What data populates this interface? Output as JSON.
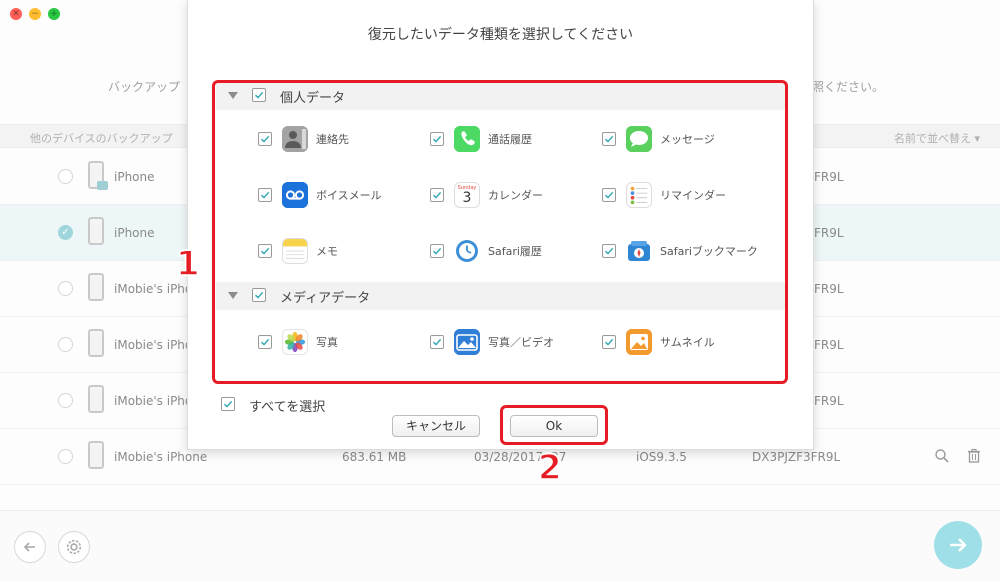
{
  "background": {
    "instruction_left": "バックアップ",
    "instruction_right": "照ください。",
    "list_header_left": "他のデバイスのバックアップ",
    "list_header_right": "名前で並べ替え ▾",
    "rows": [
      {
        "name": "iPhone",
        "selected": false,
        "locked": true,
        "tail": "FR9L"
      },
      {
        "name": "iPhone",
        "selected": true,
        "locked": false,
        "tail": "FR9L"
      },
      {
        "name": "iMobie's iPhone",
        "selected": false,
        "locked": false,
        "tail": "FR9L"
      },
      {
        "name": "iMobie's iPhone",
        "selected": false,
        "locked": false,
        "tail": "FR9L"
      },
      {
        "name": "iMobie's iPhone",
        "selected": false,
        "locked": false,
        "tail": "FR9L"
      },
      {
        "name": "iMobie's iPhone",
        "selected": false,
        "locked": false,
        "size": "683.61 MB",
        "date": "03/28/2017",
        "date_tail": "37",
        "ios": "iOS9.3.5",
        "serial": "DX3PJZF3FR9L"
      }
    ],
    "accent_color": "#9fe0e8"
  },
  "modal": {
    "title": "復元したいデータ種類を選択してください",
    "categories": [
      {
        "label": "個人データ",
        "checked": true,
        "items": [
          {
            "label": "連絡先",
            "icon": "contacts-icon",
            "checked": true
          },
          {
            "label": "通話履歴",
            "icon": "phone-icon",
            "checked": true
          },
          {
            "label": "メッセージ",
            "icon": "messages-icon",
            "checked": true
          },
          {
            "label": "ボイスメール",
            "icon": "voicemail-icon",
            "checked": true
          },
          {
            "label": "カレンダー",
            "icon": "calendar-icon",
            "checked": true,
            "icon_text_top": "Sunday",
            "icon_text_day": "3"
          },
          {
            "label": "リマインダー",
            "icon": "reminders-icon",
            "checked": true
          },
          {
            "label": "メモ",
            "icon": "notes-icon",
            "checked": true
          },
          {
            "label": "Safari履歴",
            "icon": "safari-history-icon",
            "checked": true
          },
          {
            "label": "Safariブックマーク",
            "icon": "safari-bookmark-icon",
            "checked": true
          }
        ]
      },
      {
        "label": "メディアデータ",
        "checked": true,
        "items": [
          {
            "label": "写真",
            "icon": "photos-icon",
            "checked": true
          },
          {
            "label": "写真／ビデオ",
            "icon": "photo-video-icon",
            "checked": true
          },
          {
            "label": "サムネイル",
            "icon": "thumbnail-icon",
            "checked": true
          }
        ]
      }
    ],
    "select_all_label": "すべてを選択",
    "select_all_checked": true,
    "cancel_label": "キャンセル",
    "ok_label": "Ok"
  },
  "annotations": {
    "label_1": "1",
    "label_2": "2",
    "color": "#e51c23"
  }
}
